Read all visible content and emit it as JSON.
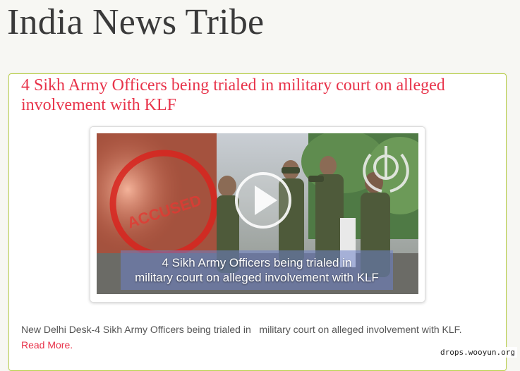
{
  "site": {
    "title": "India News Tribe"
  },
  "post": {
    "title": "4 Sikh Army Officers being trialed in military court on alleged involvement with KLF",
    "video": {
      "caption_line1": "4 Sikh Army Officers being trialed in",
      "caption_line2": "military court on alleged involvement with KLF",
      "stamp_text": "ACCUSED",
      "play_icon": "play-icon",
      "emblem_icon": "khanda-icon"
    },
    "excerpt": "New Delhi Desk-4 Sikh Army Officers being trialed in   military court on alleged involvement with KLF.",
    "read_more": "Read More."
  },
  "watermark": "drops.wooyun.org",
  "colors": {
    "title_red": "#e8334a",
    "card_border": "#b9cf4a",
    "background": "#f7f7f3"
  }
}
